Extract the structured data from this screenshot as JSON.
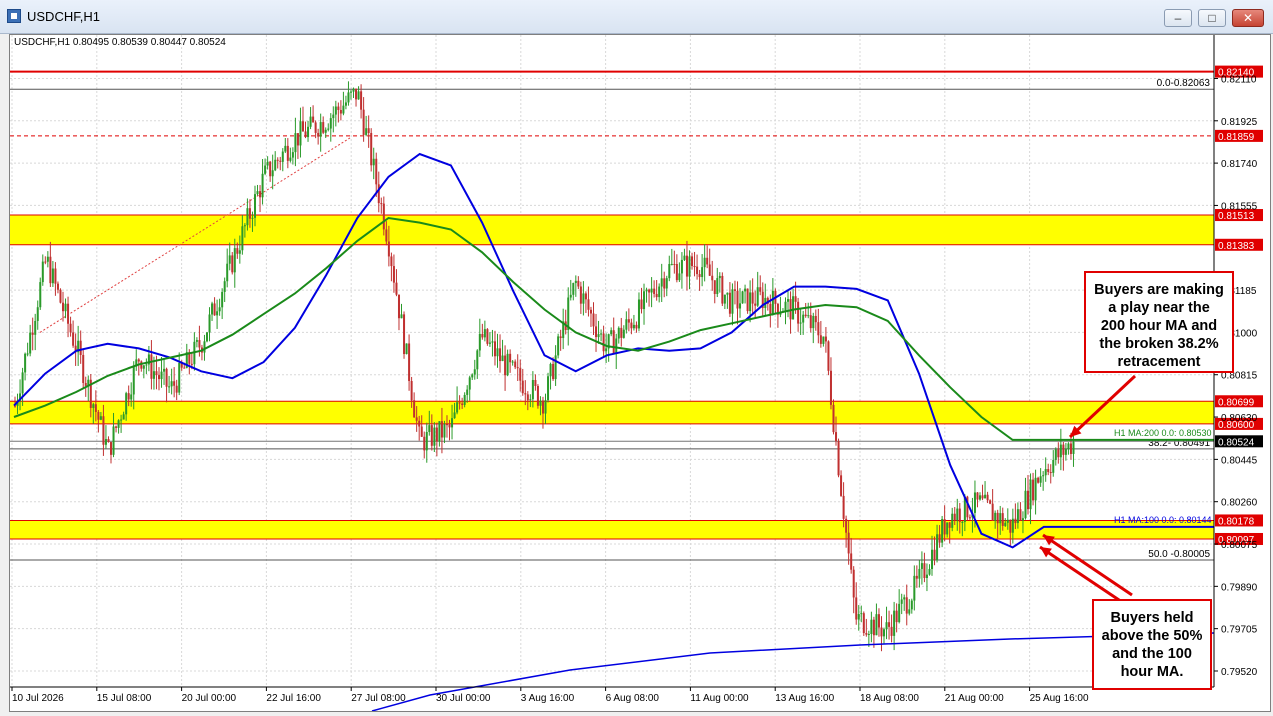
{
  "window": {
    "title": "USDCHF,H1",
    "buttons": {
      "minimize": "–",
      "maximize": "□",
      "close": "✕"
    }
  },
  "chart_data": {
    "type": "candlestick",
    "symbol_info": "USDCHF,H1  0.80495 0.80539 0.80447 0.80524",
    "price_axis_ticks": [
      "0.82110",
      "0.81925",
      "0.81740",
      "0.81555",
      "0.81185",
      "0.81000",
      "0.80815",
      "0.80630",
      "0.80445",
      "0.80260",
      "0.80075",
      "0.79890",
      "0.79705",
      "0.79520"
    ],
    "time_axis_ticks": [
      "10 Jul 2026",
      "15 Jul 08:00",
      "20 Jul 00:00",
      "22 Jul 16:00",
      "27 Jul 08:00",
      "30 Jul 00:00",
      "3 Aug 16:00",
      "6 Aug 08:00",
      "11 Aug 00:00",
      "13 Aug 16:00",
      "18 Aug 08:00",
      "21 Aug 00:00",
      "25 Aug 16:00"
    ],
    "price_range": [
      0.7945,
      0.823
    ],
    "horizontal_levels": [
      {
        "price": 0.8214,
        "label": "0.82140",
        "color": "#e00000"
      },
      {
        "price": 0.81859,
        "label": "0.81859",
        "color": "#e00000"
      },
      {
        "price": 0.81513,
        "label": "0.81513",
        "color": "#e00000"
      },
      {
        "price": 0.81383,
        "label": "0.81383",
        "color": "#e00000"
      },
      {
        "price": 0.80699,
        "label": "0.80699",
        "color": "#e00000"
      },
      {
        "price": 0.806,
        "label": "0.80600",
        "color": "#e00000"
      },
      {
        "price": 0.80178,
        "label": "0.80178",
        "color": "#e00000"
      },
      {
        "price": 0.80097,
        "label": "0.80097",
        "color": "#e00000"
      }
    ],
    "current_price": {
      "price": 0.80524,
      "label": "0.80524"
    },
    "zones": [
      {
        "from": 0.81383,
        "to": 0.81513
      },
      {
        "from": 0.806,
        "to": 0.80699
      },
      {
        "from": 0.80097,
        "to": 0.80178
      }
    ],
    "fib_levels": [
      {
        "price": 0.82063,
        "label": "0.0-0.82063"
      },
      {
        "price": 0.80491,
        "label": "38.2- 0.80491"
      },
      {
        "price": 0.80005,
        "label": "50.0 -0.80005"
      }
    ],
    "ma_labels": {
      "ma200": "H1 MA:200 0.0: 0.80530",
      "ma100": "H1 MA:100 0.0: 0.80144"
    },
    "series": [
      {
        "name": "ma100",
        "color": "#0000e0",
        "values": [
          0.8068,
          0.8082,
          0.8092,
          0.8095,
          0.8093,
          0.8089,
          0.8083,
          0.808,
          0.8087,
          0.8102,
          0.8125,
          0.815,
          0.8168,
          0.8178,
          0.8173,
          0.8148,
          0.8118,
          0.809,
          0.8083,
          0.809,
          0.8093,
          0.8092,
          0.8093,
          0.81,
          0.8112,
          0.812,
          0.812,
          0.8119,
          0.8114,
          0.8082,
          0.8042,
          0.8012,
          0.8006,
          0.8015,
          0.8015
        ]
      },
      {
        "name": "ma200",
        "color": "#1a8a1a",
        "values": [
          0.8063,
          0.8068,
          0.8074,
          0.8081,
          0.8086,
          0.8089,
          0.8092,
          0.8099,
          0.8108,
          0.8117,
          0.8128,
          0.814,
          0.815,
          0.8148,
          0.8145,
          0.8135,
          0.8122,
          0.811,
          0.81,
          0.8094,
          0.8092,
          0.8096,
          0.8101,
          0.8104,
          0.8107,
          0.811,
          0.8112,
          0.8111,
          0.8105,
          0.809,
          0.8076,
          0.8063,
          0.8053,
          0.8053,
          0.8053
        ]
      }
    ],
    "close_path": [
      0.8068,
      0.8132,
      0.8092,
      0.8048,
      0.809,
      0.8075,
      0.8096,
      0.8132,
      0.8168,
      0.8185,
      0.8193,
      0.8205,
      0.814,
      0.8052,
      0.8058,
      0.8098,
      0.8082,
      0.807,
      0.8122,
      0.8093,
      0.8108,
      0.8128,
      0.813,
      0.8113,
      0.8115,
      0.811,
      0.8098,
      0.7975,
      0.797,
      0.799,
      0.802,
      0.8025,
      0.8015,
      0.804,
      0.8052
    ]
  },
  "annotations": {
    "top_note": [
      "Buyers are making",
      "a play near the",
      "200 hour MA and",
      "the broken 38.2%",
      "retracement"
    ],
    "bottom_note": [
      "Buyers held",
      "above the 50%",
      "and the 100",
      "hour MA."
    ]
  }
}
